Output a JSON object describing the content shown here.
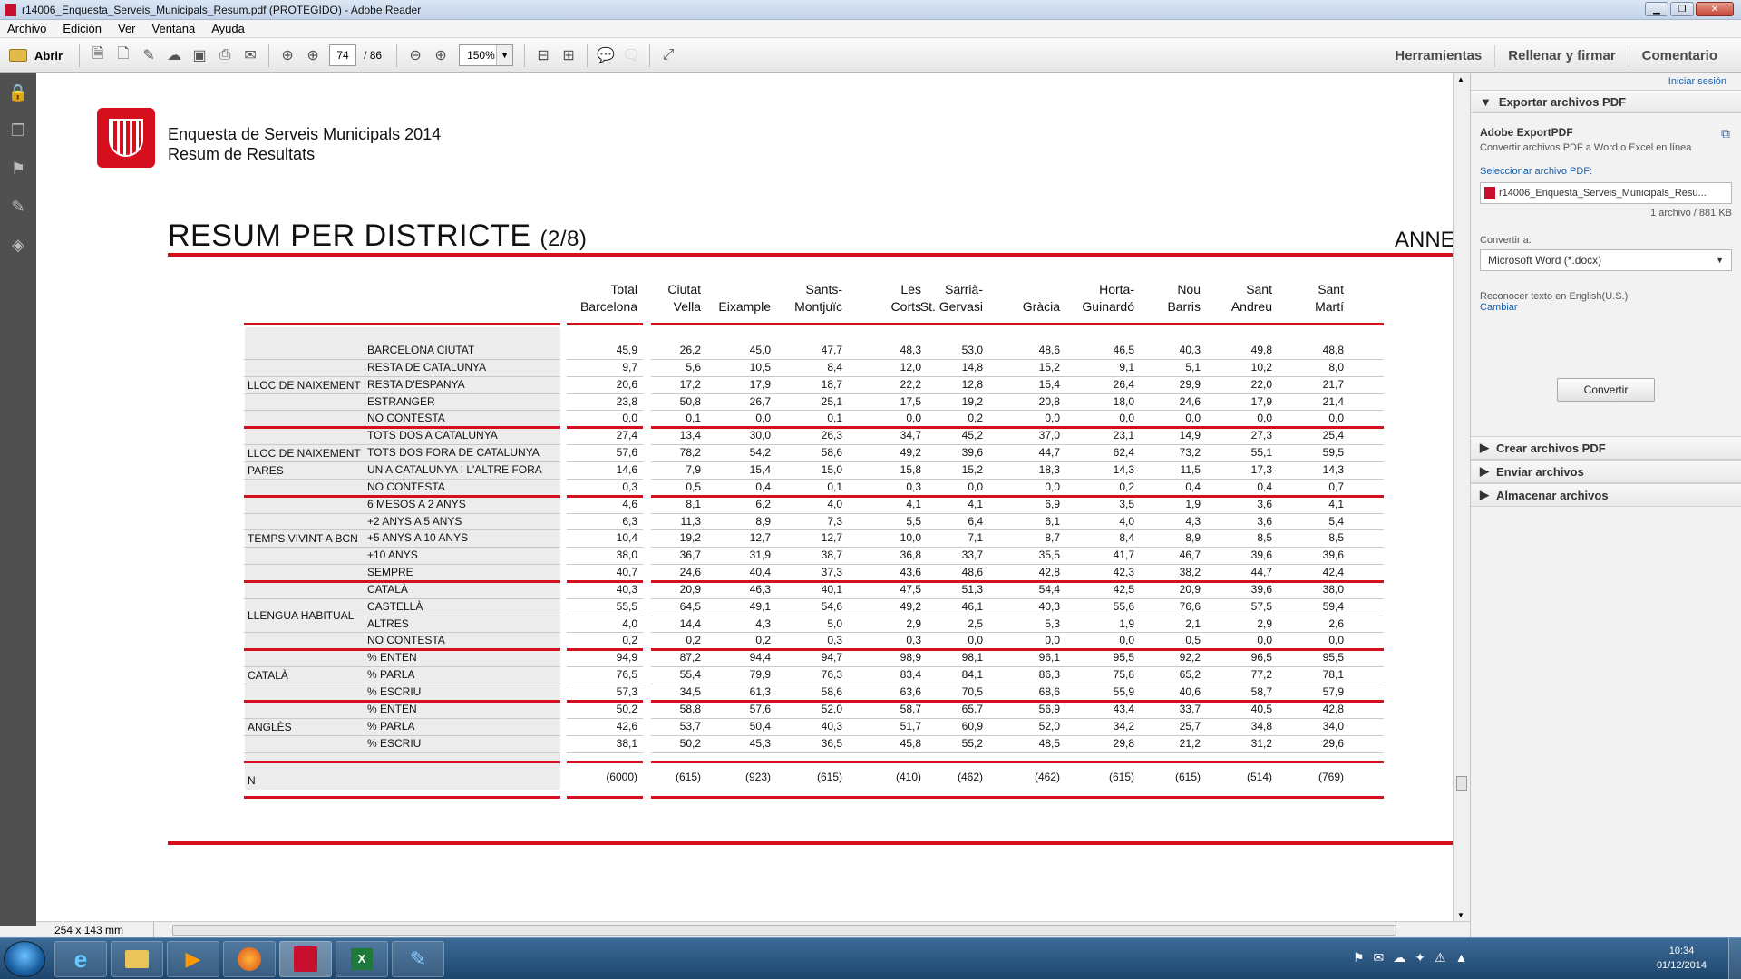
{
  "window": {
    "title": "r14006_Enquesta_Serveis_Municipals_Resum.pdf (PROTEGIDO) - Adobe Reader"
  },
  "menu": [
    "Archivo",
    "Edición",
    "Ver",
    "Ventana",
    "Ayuda"
  ],
  "toolbar": {
    "open_label": "Abrir",
    "page_current": "74",
    "page_total": "/ 86",
    "zoom": "150%"
  },
  "tabs": {
    "tools": "Herramientas",
    "sign": "Rellenar y firmar",
    "comment": "Comentario"
  },
  "document": {
    "header_line1": "Enquesta de Serveis Municipals 2014",
    "header_line2": "Resum de Resultats",
    "title": "RESUM PER DISTRICTE",
    "title_suffix": "(2/8)",
    "annex": "ANNE",
    "columns": [
      [
        "Total",
        "Barcelona"
      ],
      [
        "Ciutat",
        "Vella"
      ],
      [
        "",
        "Eixample"
      ],
      [
        "Sants-",
        "Montjuïc"
      ],
      [
        "Les",
        "Corts"
      ],
      [
        "Sarrià-",
        "St. Gervasi"
      ],
      [
        "",
        "Gràcia"
      ],
      [
        "Horta-",
        "Guinardó"
      ],
      [
        "Nou",
        "Barris"
      ],
      [
        "Sant",
        "Andreu"
      ],
      [
        "Sant",
        "Martí"
      ]
    ],
    "groups": [
      {
        "name": "LLOC DE NAIXEMENT",
        "rows": [
          {
            "label": "BARCELONA CIUTAT",
            "values": [
              "45,9",
              "26,2",
              "45,0",
              "47,7",
              "48,3",
              "53,0",
              "48,6",
              "46,5",
              "40,3",
              "49,8",
              "48,8"
            ]
          },
          {
            "label": "RESTA DE CATALUNYA",
            "values": [
              "9,7",
              "5,6",
              "10,5",
              "8,4",
              "12,0",
              "14,8",
              "15,2",
              "9,1",
              "5,1",
              "10,2",
              "8,0"
            ]
          },
          {
            "label": "RESTA D'ESPANYA",
            "values": [
              "20,6",
              "17,2",
              "17,9",
              "18,7",
              "22,2",
              "12,8",
              "15,4",
              "26,4",
              "29,9",
              "22,0",
              "21,7"
            ]
          },
          {
            "label": "ESTRANGER",
            "values": [
              "23,8",
              "50,8",
              "26,7",
              "25,1",
              "17,5",
              "19,2",
              "20,8",
              "18,0",
              "24,6",
              "17,9",
              "21,4"
            ]
          },
          {
            "label": "NO CONTESTA",
            "values": [
              "0,0",
              "0,1",
              "0,0",
              "0,1",
              "0,0",
              "0,2",
              "0,0",
              "0,0",
              "0,0",
              "0,0",
              "0,0"
            ]
          }
        ]
      },
      {
        "name": "LLOC DE NAIXEMENT PARES",
        "rows": [
          {
            "label": "TOTS DOS A CATALUNYA",
            "values": [
              "27,4",
              "13,4",
              "30,0",
              "26,3",
              "34,7",
              "45,2",
              "37,0",
              "23,1",
              "14,9",
              "27,3",
              "25,4"
            ]
          },
          {
            "label": "TOTS DOS FORA DE CATALUNYA",
            "values": [
              "57,6",
              "78,2",
              "54,2",
              "58,6",
              "49,2",
              "39,6",
              "44,7",
              "62,4",
              "73,2",
              "55,1",
              "59,5"
            ]
          },
          {
            "label": "UN A CATALUNYA I L'ALTRE FORA",
            "values": [
              "14,6",
              "7,9",
              "15,4",
              "15,0",
              "15,8",
              "15,2",
              "18,3",
              "14,3",
              "11,5",
              "17,3",
              "14,3"
            ]
          },
          {
            "label": "NO CONTESTA",
            "values": [
              "0,3",
              "0,5",
              "0,4",
              "0,1",
              "0,3",
              "0,0",
              "0,0",
              "0,2",
              "0,4",
              "0,4",
              "0,7"
            ]
          }
        ]
      },
      {
        "name": "TEMPS VIVINT A BCN",
        "rows": [
          {
            "label": "6 MESOS A 2 ANYS",
            "values": [
              "4,6",
              "8,1",
              "6,2",
              "4,0",
              "4,1",
              "4,1",
              "6,9",
              "3,5",
              "1,9",
              "3,6",
              "4,1"
            ]
          },
          {
            "label": "+2 ANYS A 5 ANYS",
            "values": [
              "6,3",
              "11,3",
              "8,9",
              "7,3",
              "5,5",
              "6,4",
              "6,1",
              "4,0",
              "4,3",
              "3,6",
              "5,4"
            ]
          },
          {
            "label": "+5 ANYS A 10 ANYS",
            "values": [
              "10,4",
              "19,2",
              "12,7",
              "12,7",
              "10,0",
              "7,1",
              "8,7",
              "8,4",
              "8,9",
              "8,5",
              "8,5"
            ]
          },
          {
            "label": "+10 ANYS",
            "values": [
              "38,0",
              "36,7",
              "31,9",
              "38,7",
              "36,8",
              "33,7",
              "35,5",
              "41,7",
              "46,7",
              "39,6",
              "39,6"
            ]
          },
          {
            "label": "SEMPRE",
            "values": [
              "40,7",
              "24,6",
              "40,4",
              "37,3",
              "43,6",
              "48,6",
              "42,8",
              "42,3",
              "38,2",
              "44,7",
              "42,4"
            ]
          }
        ]
      },
      {
        "name": "LLENGUA HABITUAL",
        "rows": [
          {
            "label": "CATALÀ",
            "values": [
              "40,3",
              "20,9",
              "46,3",
              "40,1",
              "47,5",
              "51,3",
              "54,4",
              "42,5",
              "20,9",
              "39,6",
              "38,0"
            ]
          },
          {
            "label": "CASTELLÀ",
            "values": [
              "55,5",
              "64,5",
              "49,1",
              "54,6",
              "49,2",
              "46,1",
              "40,3",
              "55,6",
              "76,6",
              "57,5",
              "59,4"
            ]
          },
          {
            "label": "ALTRES",
            "values": [
              "4,0",
              "14,4",
              "4,3",
              "5,0",
              "2,9",
              "2,5",
              "5,3",
              "1,9",
              "2,1",
              "2,9",
              "2,6"
            ]
          },
          {
            "label": "NO CONTESTA",
            "values": [
              "0,2",
              "0,2",
              "0,2",
              "0,3",
              "0,3",
              "0,0",
              "0,0",
              "0,0",
              "0,5",
              "0,0",
              "0,0"
            ]
          }
        ]
      },
      {
        "name": "CATALÀ",
        "rows": [
          {
            "label": "% ENTEN",
            "values": [
              "94,9",
              "87,2",
              "94,4",
              "94,7",
              "98,9",
              "98,1",
              "96,1",
              "95,5",
              "92,2",
              "96,5",
              "95,5"
            ]
          },
          {
            "label": "% PARLA",
            "values": [
              "76,5",
              "55,4",
              "79,9",
              "76,3",
              "83,4",
              "84,1",
              "86,3",
              "75,8",
              "65,2",
              "77,2",
              "78,1"
            ]
          },
          {
            "label": "% ESCRIU",
            "values": [
              "57,3",
              "34,5",
              "61,3",
              "58,6",
              "63,6",
              "70,5",
              "68,6",
              "55,9",
              "40,6",
              "58,7",
              "57,9"
            ]
          }
        ]
      },
      {
        "name": "ANGLÈS",
        "rows": [
          {
            "label": "% ENTEN",
            "values": [
              "50,2",
              "58,8",
              "57,6",
              "52,0",
              "58,7",
              "65,7",
              "56,9",
              "43,4",
              "33,7",
              "40,5",
              "42,8"
            ]
          },
          {
            "label": "% PARLA",
            "values": [
              "42,6",
              "53,7",
              "50,4",
              "40,3",
              "51,7",
              "60,9",
              "52,0",
              "34,2",
              "25,7",
              "34,8",
              "34,0"
            ]
          },
          {
            "label": "% ESCRIU",
            "values": [
              "38,1",
              "50,2",
              "45,3",
              "36,5",
              "45,8",
              "55,2",
              "48,5",
              "29,8",
              "21,2",
              "31,2",
              "29,6"
            ]
          }
        ]
      }
    ],
    "n_row": {
      "label": "N",
      "values": [
        "(6000)",
        "(615)",
        "(923)",
        "(615)",
        "(410)",
        "(462)",
        "(462)",
        "(615)",
        "(615)",
        "(514)",
        "(769)"
      ]
    }
  },
  "right_panel": {
    "login": "Iniciar sesión",
    "export_header": "Exportar archivos PDF",
    "service": "Adobe ExportPDF",
    "service_desc": "Convertir archivos PDF a Word o Excel en línea",
    "select_label": "Seleccionar archivo PDF:",
    "file_name": "r14006_Enquesta_Serveis_Municipals_Resu...",
    "file_info": "1 archivo / 881 KB",
    "convert_to": "Convertir a:",
    "format": "Microsoft Word (*.docx)",
    "ocr_text": "Reconocer texto en English(U.S.)",
    "change": "Cambiar",
    "convert_button": "Convertir",
    "create": "Crear archivos PDF",
    "send": "Enviar archivos",
    "store": "Almacenar archivos"
  },
  "status": {
    "page_size": "254 x 143 mm"
  },
  "clock": {
    "time": "10:34",
    "date": "01/12/2014"
  }
}
